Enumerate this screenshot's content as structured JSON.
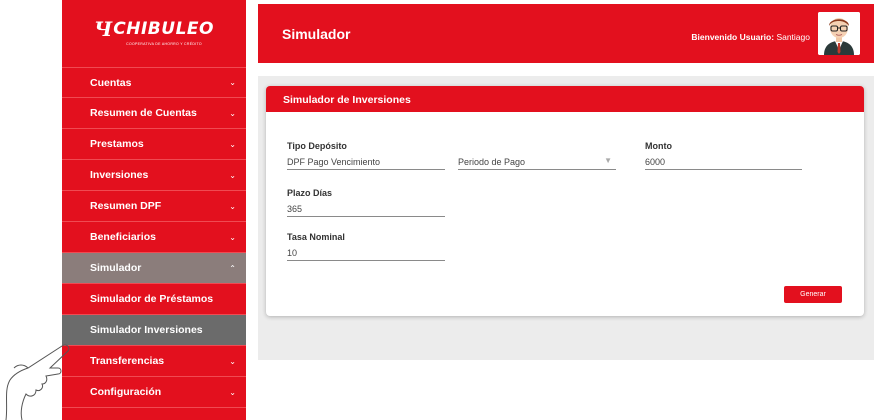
{
  "brand": {
    "name": "CHIBULEO",
    "tagline": "COOPERATIVA DE AHORRO Y CRÉDITO",
    "mark": "Ч"
  },
  "header": {
    "title": "Simulador",
    "welcome_label": "Bienvenido Usuario:",
    "user_name": "Santiago"
  },
  "sidebar": {
    "items": [
      {
        "label": "Cuentas",
        "chev": "⌄"
      },
      {
        "label": "Resumen de Cuentas",
        "chev": "⌄"
      },
      {
        "label": "Prestamos",
        "chev": "⌄"
      },
      {
        "label": "Inversiones",
        "chev": "⌄"
      },
      {
        "label": "Resumen DPF",
        "chev": "⌄"
      },
      {
        "label": "Beneficiarios",
        "chev": "⌄"
      },
      {
        "label": "Simulador",
        "chev": "⌃"
      },
      {
        "label": "Simulador de Préstamos"
      },
      {
        "label": "Simulador Inversiones"
      },
      {
        "label": "Transferencias",
        "chev": "⌄"
      },
      {
        "label": "Configuración",
        "chev": "⌄"
      }
    ]
  },
  "card": {
    "title": "Simulador de Inversiones",
    "tipo_label": "Tipo Depósito",
    "tipo_value": "DPF Pago Vencimiento",
    "periodo_value": "Periodo de Pago",
    "monto_label": "Monto",
    "monto_value": "6000",
    "plazo_label": "Plazo Días",
    "plazo_value": "365",
    "tasa_label": "Tasa Nominal",
    "tasa_value": "10",
    "generate_label": "Generar"
  },
  "colors": {
    "brand_red": "#e3101e",
    "active_gray": "#6b6b6b",
    "open_gray": "#8b7d7b"
  }
}
